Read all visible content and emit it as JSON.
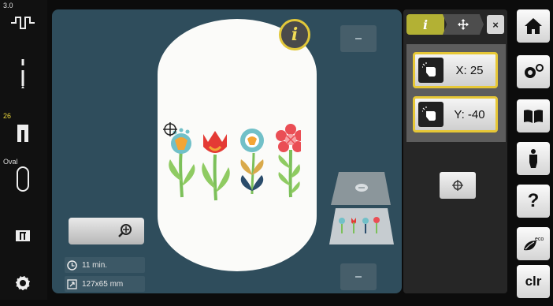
{
  "leftbar": {
    "tension_value": "3.0",
    "needle_pos_value": "26",
    "hoop_label": "Oval"
  },
  "canvas": {
    "info_label": "i",
    "stitch_time": "11 min.",
    "design_size": "127x65 mm"
  },
  "panel": {
    "tab_info_label": "i",
    "close_label": "×",
    "x_value": "X: 25",
    "y_value": "Y: -40"
  },
  "rightbar": {
    "eco_label": "eco",
    "clr_label": "clr",
    "help_label": "?"
  },
  "colors": {
    "canvas_bg": "#2f4d5c",
    "accent_yellow": "#e6c736",
    "tab_green": "#b3b134"
  },
  "icons": [
    "tension-icon",
    "needle-icon",
    "presser-foot-icon",
    "hoop-icon",
    "stitch-plate-icon",
    "bobbin-icon",
    "zoom-in-icon",
    "clock-icon",
    "resize-icon",
    "move-icon",
    "hand-icon",
    "crosshair-icon",
    "home-icon",
    "settings-icon",
    "book-icon",
    "tutorial-icon",
    "help-icon",
    "eco-icon"
  ]
}
